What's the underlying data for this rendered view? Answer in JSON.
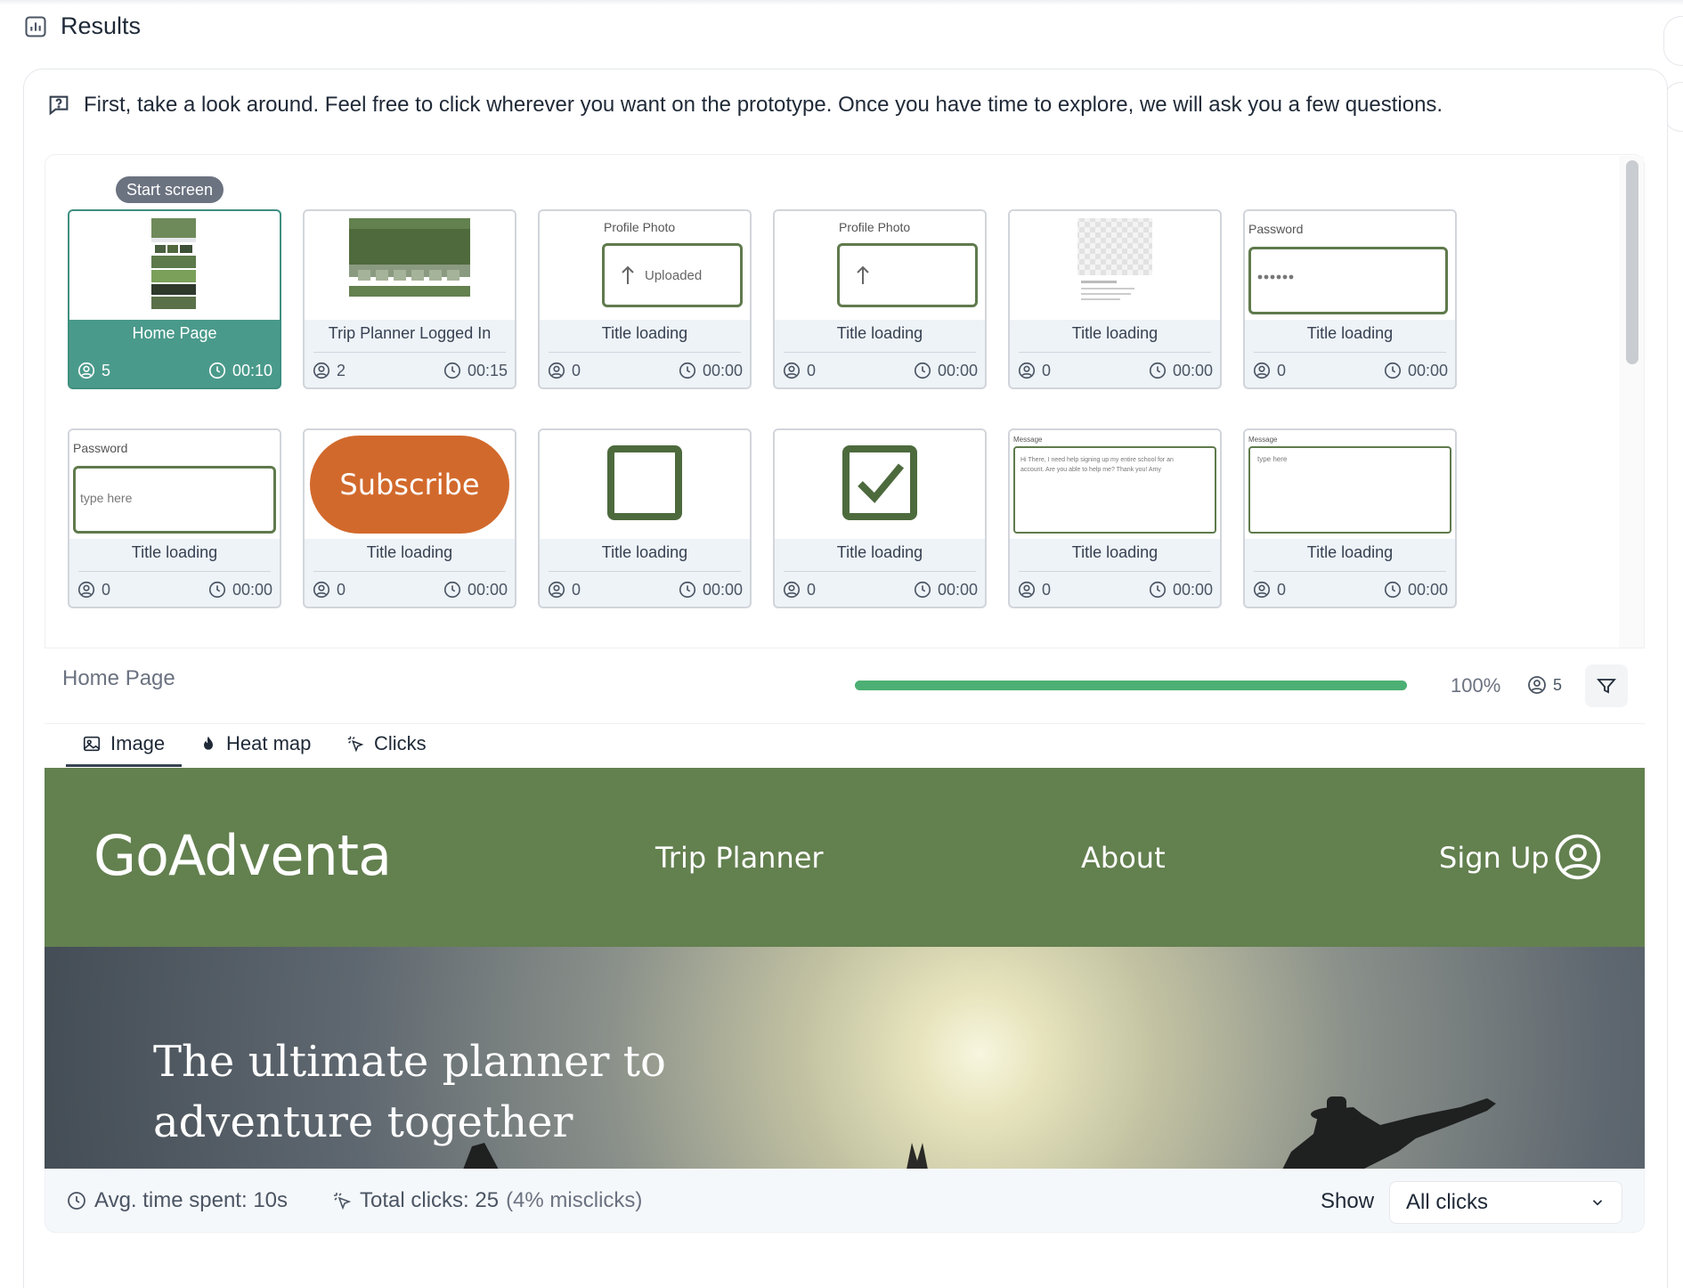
{
  "header": {
    "title": "Results",
    "icon": "bar-chart-icon"
  },
  "instruction": {
    "icon": "message-question-icon",
    "text": "First, take a look around. Feel free to click wherever you want on the prototype. Once you have time to explore, we will ask you a few questions."
  },
  "start_badge": "Start screen",
  "screens": [
    {
      "name": "Home Page",
      "users": "5",
      "time": "00:10",
      "active": true
    },
    {
      "name": "Trip Planner Logged In",
      "users": "2",
      "time": "00:15"
    },
    {
      "name": "Title loading",
      "users": "0",
      "time": "00:00",
      "thumb_label": "Profile Photo",
      "thumb_text": "Uploaded"
    },
    {
      "name": "Title loading",
      "users": "0",
      "time": "00:00",
      "thumb_label": "Profile Photo"
    },
    {
      "name": "Title loading",
      "users": "0",
      "time": "00:00"
    },
    {
      "name": "Title loading",
      "users": "0",
      "time": "00:00",
      "thumb_label": "Password"
    },
    {
      "name": "Title loading",
      "users": "0",
      "time": "00:00",
      "thumb_label": "Password",
      "thumb_text": "type here"
    },
    {
      "name": "Title loading",
      "users": "0",
      "time": "00:00",
      "thumb_text": "Subscribe"
    },
    {
      "name": "Title loading",
      "users": "0",
      "time": "00:00"
    },
    {
      "name": "Title loading",
      "users": "0",
      "time": "00:00"
    },
    {
      "name": "Title loading",
      "users": "0",
      "time": "00:00",
      "thumb_label": "Message",
      "thumb_text": "Hi There, I need help signing up my entire school for an account. Are you able to help me? Thank you! Amy"
    },
    {
      "name": "Title loading",
      "users": "0",
      "time": "00:00",
      "thumb_label": "Message",
      "thumb_text": "type here"
    }
  ],
  "detail": {
    "title": "Home Page",
    "progress": 100,
    "progress_text": "100%",
    "users": "5"
  },
  "tabs": [
    {
      "label": "Image",
      "icon": "image-icon",
      "selected": true
    },
    {
      "label": "Heat map",
      "icon": "flame-icon"
    },
    {
      "label": "Clicks",
      "icon": "pointer-click-icon"
    }
  ],
  "preview": {
    "brand": "GoAdventa",
    "nav": [
      "Trip Planner",
      "About",
      "Sign Up"
    ],
    "hero_text": "The ultimate planner to adventure together"
  },
  "footer": {
    "avg_label": "Avg. time spent: 10s",
    "clicks_label": "Total clicks: 25",
    "misclicks": "(4% misclicks)",
    "show_label": "Show",
    "show_value": "All clicks"
  },
  "colors": {
    "accent_teal": "#4a9a8b",
    "progress_green": "#4caf73",
    "preview_green": "#63804f",
    "subscribe_orange": "#d2692c"
  }
}
